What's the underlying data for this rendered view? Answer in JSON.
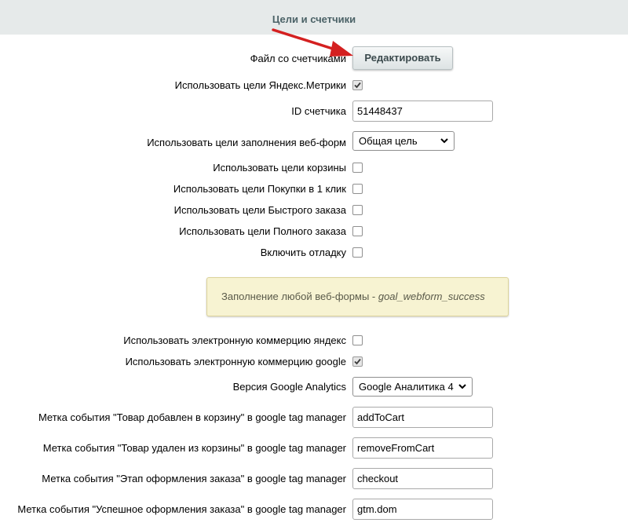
{
  "header": {
    "title": "Цели и счетчики"
  },
  "counters_file": {
    "label": "Файл со счетчиками",
    "button_label": "Редактировать"
  },
  "use_yandex_goals": {
    "label": "Использовать цели Яндекс.Метрики",
    "checked": true
  },
  "counter_id": {
    "label": "ID счетчика",
    "value": "51448437"
  },
  "webform_goals": {
    "label": "Использовать цели заполнения веб-форм",
    "selected": "Общая цель"
  },
  "checkbox_options": [
    {
      "label": "Использовать цели корзины",
      "checked": false
    },
    {
      "label": "Использовать цели Покупки в 1 клик",
      "checked": false
    },
    {
      "label": "Использовать цели Быстрого заказа",
      "checked": false
    },
    {
      "label": "Использовать цели Полного заказа",
      "checked": false
    },
    {
      "label": "Включить отладку",
      "checked": false
    }
  ],
  "note": {
    "prefix": "Заполнение любой веб-формы - ",
    "goal": "goal_webform_success"
  },
  "ecommerce_yandex": {
    "label": "Использовать электронную коммерцию яндекс",
    "checked": false
  },
  "ecommerce_google": {
    "label": "Использовать электронную коммерцию google",
    "checked": true
  },
  "ga_version": {
    "label": "Версия Google Analytics",
    "selected": "Google Аналитика 4"
  },
  "gtm_events": [
    {
      "label": "Метка события \"Товар добавлен в корзину\" в google tag manager",
      "value": "addToCart"
    },
    {
      "label": "Метка события \"Товар удален из корзины\" в google tag manager",
      "value": "removeFromCart"
    },
    {
      "label": "Метка события \"Этап оформления заказа\" в google tag manager",
      "value": "checkout"
    },
    {
      "label": "Метка события \"Успешное оформления заказа\" в google tag manager",
      "value": "gtm.dom"
    }
  ],
  "colors": {
    "header_bg": "#e6eaea",
    "header_text": "#4b6267",
    "note_bg": "#f7f3d2",
    "arrow": "#d42020"
  },
  "icons": {
    "checkmark": "check-icon",
    "dropdown": "chevron-down-icon",
    "annotation": "red-arrow-annotation"
  }
}
